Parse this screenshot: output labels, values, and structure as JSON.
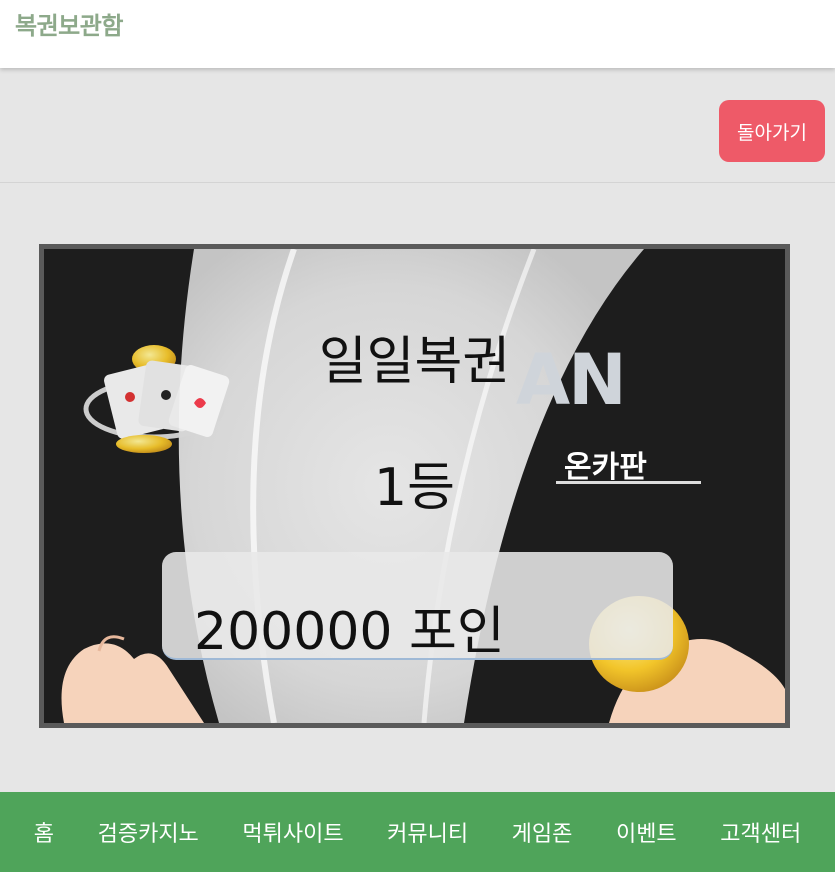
{
  "header": {
    "title": "복권보관함"
  },
  "toolbar": {
    "back_label": "돌아가기"
  },
  "lottery": {
    "name": "일일복권",
    "rank": "1등",
    "prize": "200000 포인",
    "brand": "AN",
    "brand_sub": "온카판"
  },
  "nav": {
    "items": [
      "홈",
      "검증카지노",
      "먹튀사이트",
      "커뮤니티",
      "게임존",
      "이벤트",
      "고객센터"
    ]
  },
  "colors": {
    "accent": "#ee5a68",
    "nav_bg": "#4fa45a",
    "title": "#8da98a"
  }
}
